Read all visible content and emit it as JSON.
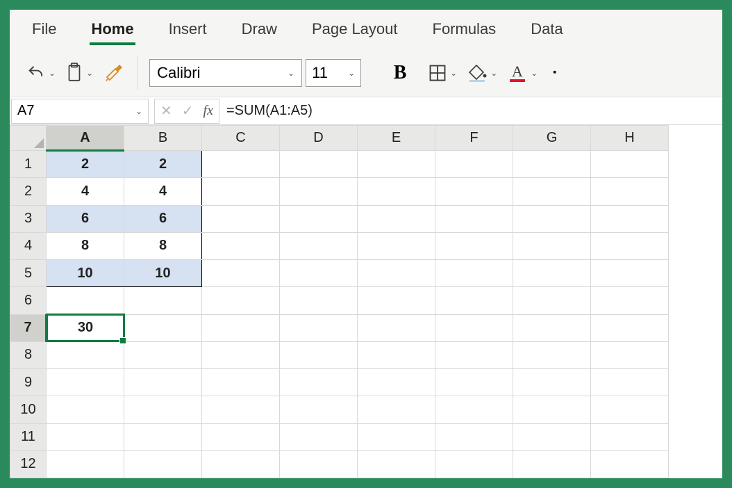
{
  "tabs": {
    "file": "File",
    "home": "Home",
    "insert": "Insert",
    "draw": "Draw",
    "page_layout": "Page Layout",
    "formulas": "Formulas",
    "data": "Data"
  },
  "toolbar": {
    "font_name": "Calibri",
    "font_size": "11"
  },
  "formula_bar": {
    "name_box": "A7",
    "formula": "=SUM(A1:A5)"
  },
  "columns": [
    "A",
    "B",
    "C",
    "D",
    "E",
    "F",
    "G",
    "H"
  ],
  "rows": [
    "1",
    "2",
    "3",
    "4",
    "5",
    "6",
    "7",
    "8",
    "9",
    "10",
    "11",
    "12"
  ],
  "active_col": "A",
  "active_row": "7",
  "cells": {
    "A1": "2",
    "B1": "2",
    "A2": "4",
    "B2": "4",
    "A3": "6",
    "B3": "6",
    "A4": "8",
    "B4": "8",
    "A5": "10",
    "B5": "10",
    "A7": "30"
  },
  "chart_data": {
    "type": "table",
    "columns": [
      "A",
      "B"
    ],
    "rows": [
      [
        2,
        2
      ],
      [
        4,
        4
      ],
      [
        6,
        6
      ],
      [
        8,
        8
      ],
      [
        10,
        10
      ]
    ],
    "computed": {
      "A7": 30,
      "formula": "=SUM(A1:A5)"
    }
  }
}
